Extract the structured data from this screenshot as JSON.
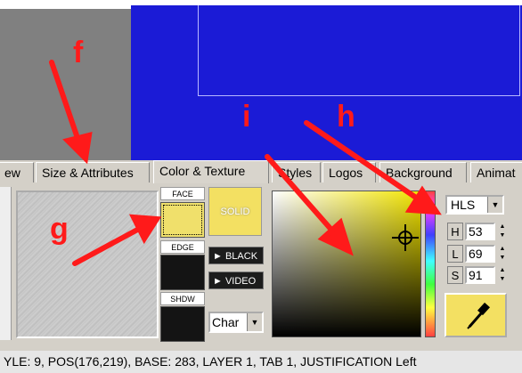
{
  "tabs": [
    "ew",
    "Size & Attributes",
    "Color & Texture",
    "Styles",
    "Logos",
    "Background",
    "Animat"
  ],
  "swatches": {
    "face_label": "FACE",
    "edge_label": "EDGE",
    "shdw_label": "SHDW"
  },
  "buttons": {
    "solid": "SOLID",
    "black": "BLACK",
    "video": "VIDEO"
  },
  "char_select": {
    "value": "Char"
  },
  "color_mode": {
    "value": "HLS"
  },
  "hls": {
    "h_label": "H",
    "h_value": "53",
    "l_label": "L",
    "l_value": "69",
    "s_label": "S",
    "s_value": "91"
  },
  "status_bar": {
    "text": "YLE: 9, POS(176,219), BASE: 283, LAYER 1, TAB 1, JUSTIFICATION Left"
  },
  "annotations": {
    "f": "f",
    "g": "g",
    "h": "h",
    "i": "i"
  },
  "colors": {
    "face": "#f0e06b",
    "canvas_blue": "#1b1bd6",
    "annotation_red": "#ff1a1a",
    "solid_yellow": "#f3e062"
  },
  "icons": {
    "crosshair": "crosshair-icon",
    "eyedropper": "eyedropper-icon",
    "triangle_right": "triangle-right-icon",
    "dropdown": "chevron-down-icon"
  }
}
